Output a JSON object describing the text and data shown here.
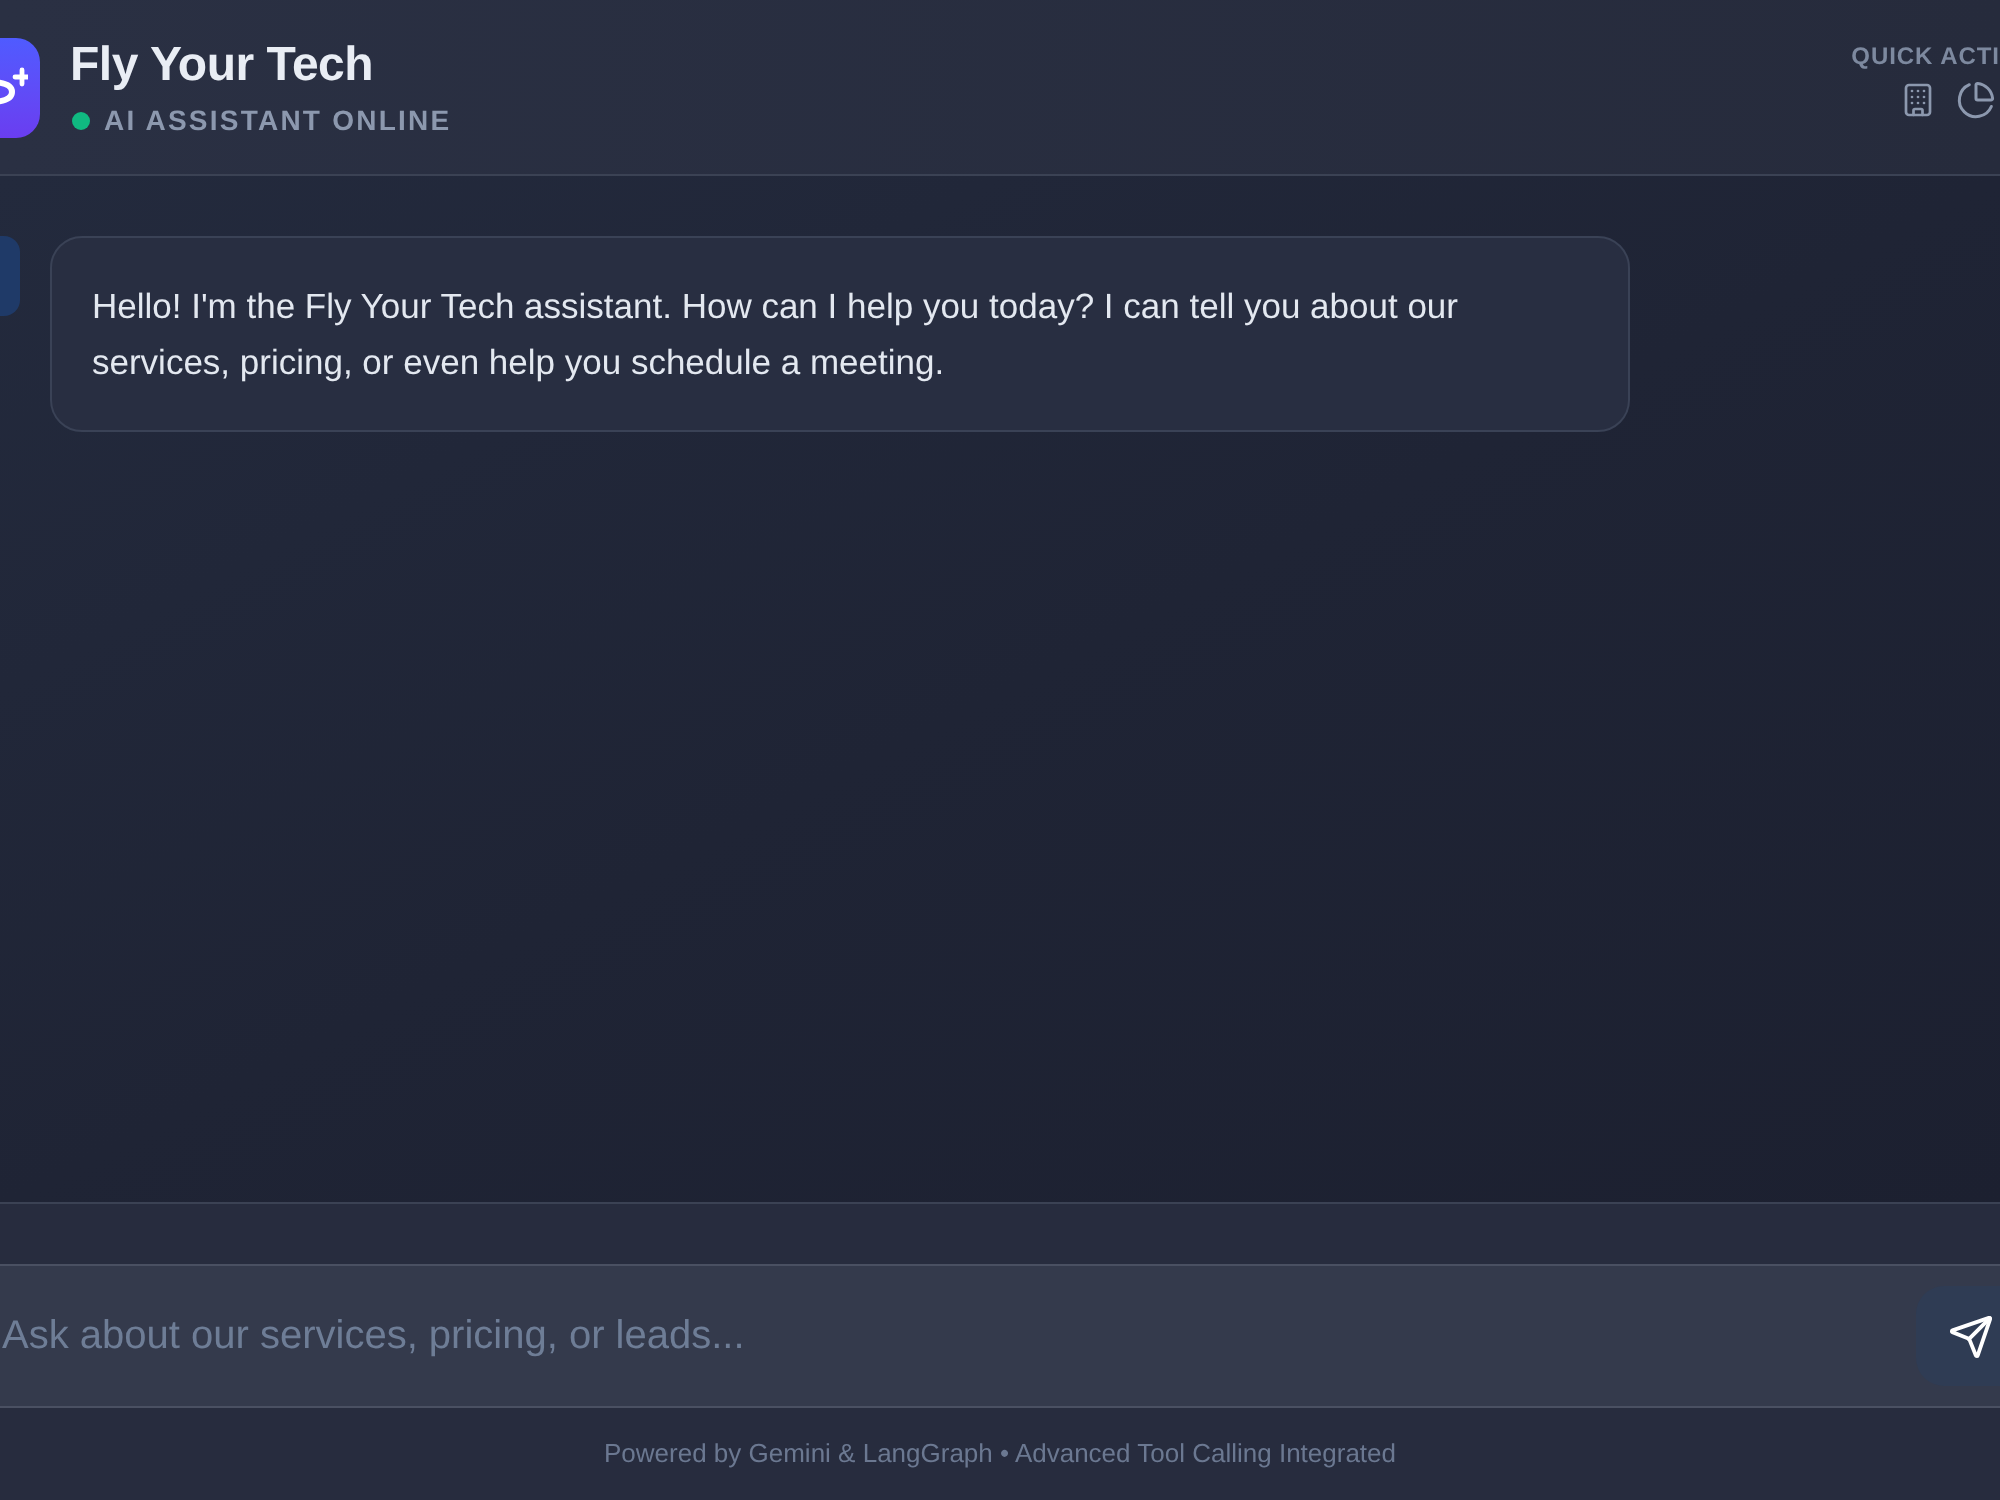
{
  "header": {
    "title": "Fly Your Tech",
    "status": {
      "label": "AI ASSISTANT ONLINE",
      "online": true
    },
    "quick_actions": {
      "label": "QUICK ACTI"
    }
  },
  "messages": [
    {
      "kind": "assistant",
      "text": "Hello! I'm the Fly Your Tech assistant. How can I help you today? I can tell you about our services, pricing, or even help you schedule a meeting."
    }
  ],
  "composer": {
    "placeholder": "Ask about our services, pricing, or leads..."
  },
  "footer": "Powered by Gemini & LangGraph • Advanced Tool Calling Integrated"
}
